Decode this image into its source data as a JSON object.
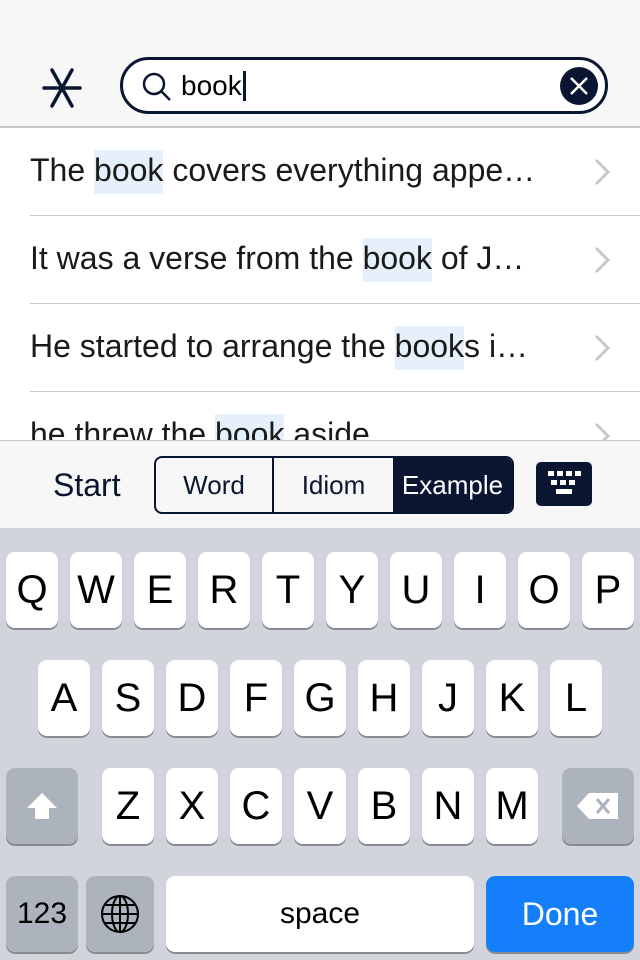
{
  "search": {
    "query": "book"
  },
  "results": [
    {
      "before": "The ",
      "match": "book",
      "after": " covers everything appe…"
    },
    {
      "before": "It was a verse from the ",
      "match": "book",
      "after": " of J…"
    },
    {
      "before": "He started to arrange the ",
      "match": "book",
      "after": "s i…"
    },
    {
      "before": "he threw the ",
      "match": "book",
      "after": " aside"
    }
  ],
  "filter": {
    "start_label": "Start",
    "segments": [
      "Word",
      "Idiom",
      "Example"
    ],
    "selected": "Example"
  },
  "keyboard": {
    "row1": [
      "Q",
      "W",
      "E",
      "R",
      "T",
      "Y",
      "U",
      "I",
      "O",
      "P"
    ],
    "row2": [
      "A",
      "S",
      "D",
      "F",
      "G",
      "H",
      "J",
      "K",
      "L"
    ],
    "row3": [
      "Z",
      "X",
      "C",
      "V",
      "B",
      "N",
      "M"
    ],
    "numbers": "123",
    "space": "space",
    "done": "Done"
  },
  "colors": {
    "accent": "#0a1631",
    "highlight": "#e6f0fb",
    "done": "#157efb"
  }
}
